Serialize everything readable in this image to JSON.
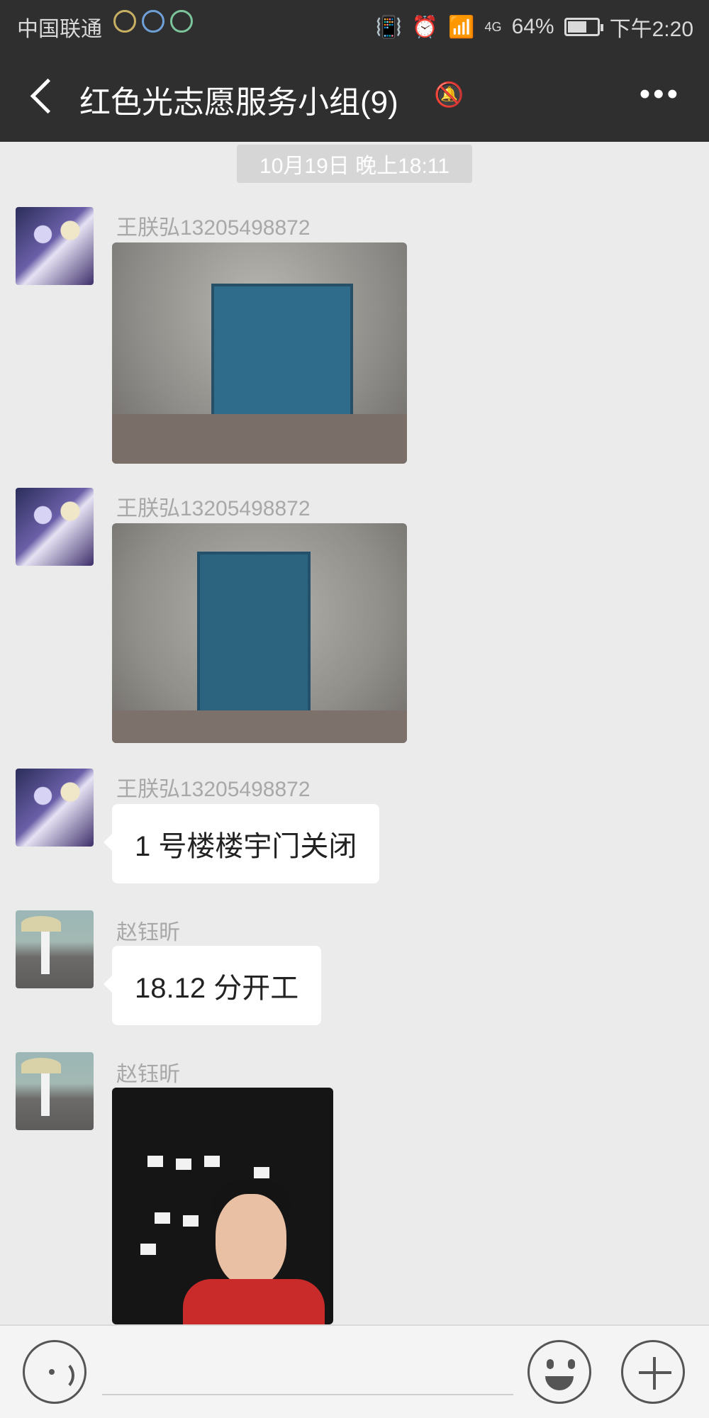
{
  "status_bar": {
    "carrier": "中国联通",
    "battery_percent": "64%",
    "battery_level": 0.64,
    "time": "下午2:20",
    "network": "4G"
  },
  "header": {
    "title": "红色光志愿服务小组(9)",
    "back_icon": "back-arrow-icon",
    "mute_icon": "bell-mute-icon",
    "more_icon": "more-dots-icon"
  },
  "chat": {
    "timestamp": "10月19日 晚上18:11",
    "messages": [
      {
        "sender": "王朕弘13205498872",
        "type": "image",
        "avatar": "anime-avatar"
      },
      {
        "sender": "王朕弘13205498872",
        "type": "image",
        "avatar": "anime-avatar"
      },
      {
        "sender": "王朕弘13205498872",
        "type": "text",
        "text": "1 号楼楼宇门关闭",
        "avatar": "anime-avatar"
      },
      {
        "sender": "赵钰昕",
        "type": "text",
        "text": "18.12 分开工",
        "avatar": "umbrella-photo-avatar"
      },
      {
        "sender": "赵钰昕",
        "type": "image",
        "avatar": "umbrella-photo-avatar"
      }
    ]
  },
  "input_bar": {
    "voice_icon": "voice-icon",
    "emoji_icon": "emoji-icon",
    "plus_icon": "plus-icon",
    "input_value": ""
  }
}
